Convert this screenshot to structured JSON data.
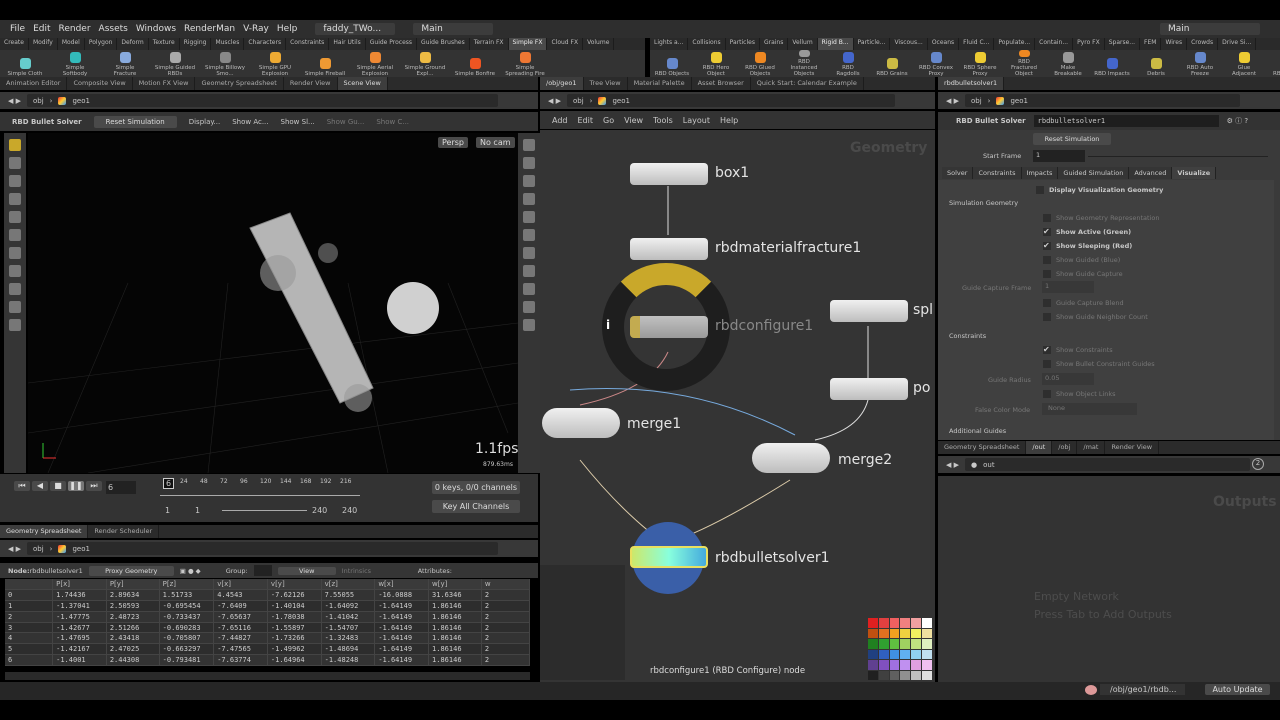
{
  "menu": [
    "File",
    "Edit",
    "Render",
    "Assets",
    "Windows",
    "RenderMan",
    "V-Ray",
    "Help"
  ],
  "desktop": {
    "file": "faddy_TWo...",
    "desk_left": "Main",
    "desk_right": "Main"
  },
  "shelf_tabs_left": [
    "Create",
    "Modify",
    "Model",
    "Polygon",
    "Deform",
    "Texture",
    "Rigging",
    "Muscles",
    "Characters",
    "Constraints",
    "Hair Utils",
    "Guide Process",
    "Guide Brushes",
    "Terrain FX",
    "Simple FX",
    "Cloud FX",
    "Volume"
  ],
  "shelf_tabs_right": [
    "Lights a...",
    "Collisions",
    "Particles",
    "Grains",
    "Vellum",
    "Rigid B...",
    "Particle...",
    "Viscous...",
    "Oceans",
    "Fluid C...",
    "Populate...",
    "Contain...",
    "Pyro FX",
    "Sparse...",
    "FEM",
    "Wires",
    "Crowds",
    "Drive Si..."
  ],
  "shelf_tools_left": [
    "Simple Cloth",
    "Simple Softbody",
    "Simple Fracture",
    "Simple Guided RBDs",
    "Simple Billowy Smo...",
    "Simple GPU Explosion",
    "Simple Fireball",
    "Simple Aerial Explosion",
    "Simple Ground Expl...",
    "Simple Bonfire",
    "Simple Spreading Fire"
  ],
  "shelf_tools_right": [
    "RBD Objects",
    "RBD Hero Object",
    "RBD Glued Objects",
    "RBD Instanced Objects",
    "RBD Ragdolls",
    "RBD Grains",
    "RBD Convex Proxy",
    "RBD Sphere Proxy",
    "RBD Fractured Object",
    "Make Breakable",
    "RBD Impacts",
    "Debris",
    "RBD Auto Freeze",
    "Glue Adjacent",
    "RB Pin Con"
  ],
  "left_pane": {
    "tabs": [
      "Animation Editor",
      "Composite View",
      "Motion FX View",
      "Geometry Spreadsheet",
      "Render View",
      "Scene View"
    ],
    "path": [
      "obj",
      "geo1"
    ],
    "toolbar": {
      "node_type": "RBD Bullet Solver",
      "reset": "Reset Simulation",
      "display": "Display...",
      "show_active": "Show Ac...",
      "show_sleeping": "Show Sl...",
      "show_guided": "Show Gu...",
      "show_constraints": "Show C..."
    },
    "viewport": {
      "camera": "Persp",
      "cam": "No cam",
      "fps": "1.1fps",
      "ms": "879.63ms"
    }
  },
  "timeline": {
    "frame": "6",
    "ticks": [
      "24",
      "48",
      "72",
      "96",
      "120",
      "144",
      "168",
      "192",
      "216"
    ],
    "start": "1",
    "start2": "1",
    "end": "240",
    "end2": "240",
    "keys": "0 keys, 0/0 channels",
    "key_all": "Key All Channels",
    "progress_frame": 6,
    "range_total": 240
  },
  "spreadsheet": {
    "tabs": [
      "Geometry Spreadsheet",
      "Render Scheduler"
    ],
    "path": [
      "obj",
      "geo1"
    ],
    "node_label": "Node:",
    "node": "rbdbulletsolver1",
    "mode": "Proxy Geometry",
    "group_label": "Group:",
    "view": "View",
    "intrinsics": "Intrinsics",
    "attributes": "Attributes:",
    "columns": [
      "",
      "P[x]",
      "P[y]",
      "P[z]",
      "v[x]",
      "v[y]",
      "v[z]",
      "w[x]",
      "w[y]",
      "w"
    ],
    "rows": [
      [
        "0",
        "1.74436",
        "2.89634",
        "1.51733",
        "4.4543",
        "-7.62126",
        "7.55055",
        "-16.0888",
        "31.6346",
        "2"
      ],
      [
        "1",
        "-1.37041",
        "2.50593",
        "-0.695454",
        "-7.6409",
        "-1.40104",
        "-1.64092",
        "-1.64149",
        "1.86146",
        "2"
      ],
      [
        "2",
        "-1.47775",
        "2.48723",
        "-0.733437",
        "-7.65637",
        "-1.78038",
        "-1.41042",
        "-1.64149",
        "1.86146",
        "2"
      ],
      [
        "3",
        "-1.42677",
        "2.51266",
        "-0.690283",
        "-7.65116",
        "-1.55897",
        "-1.54707",
        "-1.64149",
        "1.86146",
        "2"
      ],
      [
        "4",
        "-1.47695",
        "2.43418",
        "-0.705807",
        "-7.44827",
        "-1.73266",
        "-1.32483",
        "-1.64149",
        "1.86146",
        "2"
      ],
      [
        "5",
        "-1.42167",
        "2.47025",
        "-0.663297",
        "-7.47565",
        "-1.49962",
        "-1.48694",
        "-1.64149",
        "1.86146",
        "2"
      ],
      [
        "6",
        "-1.4001",
        "2.44308",
        "-0.793481",
        "-7.63774",
        "-1.64964",
        "-1.48248",
        "-1.64149",
        "1.86146",
        "2"
      ]
    ]
  },
  "network": {
    "tabs": [
      "/obj/geo1",
      "Tree View",
      "Material Palette",
      "Asset Browser",
      "Quick Start: Calendar Example"
    ],
    "path": [
      "obj",
      "geo1"
    ],
    "menu": [
      "Add",
      "Edit",
      "Go",
      "View",
      "Tools",
      "Layout",
      "Help"
    ],
    "context": "Geometry",
    "nodes": {
      "box": "box1",
      "fracture": "rbdmaterialfracture1",
      "configure": "rbdconfigure1",
      "sphere": "spl",
      "po": "po",
      "merge1": "merge1",
      "merge2": "merge2",
      "solver": "rbdbulletsolver1"
    },
    "info_icon": "i",
    "status": "rbdconfigure1 (RBD Configure) node",
    "palette": [
      "#e02020",
      "#e04040",
      "#f06060",
      "#f08080",
      "#f0a0a0",
      "#ffffff",
      "#c05010",
      "#e07020",
      "#f0a020",
      "#f0d040",
      "#f0f060",
      "#f0e0a0",
      "#208020",
      "#30a030",
      "#60c040",
      "#a0d060",
      "#c0e080",
      "#e0f0c0",
      "#204080",
      "#3060c0",
      "#4090e0",
      "#60b0f0",
      "#90d0f0",
      "#c0e0f0",
      "#604090",
      "#8050c0",
      "#a070e0",
      "#c090f0",
      "#e0a0e0",
      "#f0c0f0",
      "#202020",
      "#404040",
      "#606060",
      "#909090",
      "#c0c0c0",
      "#e0e0e0"
    ]
  },
  "params": {
    "tab": "rbdbulletsolver1",
    "path": [
      "obj",
      "geo1"
    ],
    "node_type": "RBD Bullet Solver",
    "node_name": "rbdbulletsolver1",
    "reset": "Reset Simulation",
    "start_frame_label": "Start Frame",
    "start_frame": "1",
    "tabs": [
      "Solver",
      "Constraints",
      "Impacts",
      "Guided Simulation",
      "Advanced",
      "Visualize"
    ],
    "display_vis": "Display Visualization Geometry",
    "sim_geo": "Simulation Geometry",
    "sim_items": [
      {
        "label": "Show Geometry Representation",
        "checked": false,
        "enabled": false
      },
      {
        "label": "Show Active (Green)",
        "checked": true,
        "enabled": true
      },
      {
        "label": "Show Sleeping (Red)",
        "checked": true,
        "enabled": true
      },
      {
        "label": "Show Guided (Blue)",
        "checked": false,
        "enabled": false
      },
      {
        "label": "Show Guide Capture",
        "checked": false,
        "enabled": false
      }
    ],
    "guide_capture_frame_label": "Guide Capture Frame",
    "guide_capture_frame": "1",
    "guide_items": [
      "Guide Capture Blend",
      "Show Guide Neighbor Count"
    ],
    "constraints": "Constraints",
    "show_constraints": "Show Constraints",
    "show_bullet": "Show Bullet Constraint Guides",
    "guide_radius_label": "Guide Radius",
    "guide_radius": "0.05",
    "show_links": "Show Object Links",
    "false_color_label": "False Color Mode",
    "false_color": "None",
    "additional": "Additional Guides"
  },
  "lower_right": {
    "tabs": [
      "Geometry Spreadsheet",
      "/out",
      "/obj",
      "/mat",
      "Render View"
    ],
    "path": "out",
    "badge": "2",
    "title": "Outputs",
    "empty1": "Empty Network",
    "empty2": "Press Tab to Add Outputs"
  },
  "statusbar": {
    "path": "/obj/geo1/rbdb...",
    "update": "Auto Update"
  }
}
